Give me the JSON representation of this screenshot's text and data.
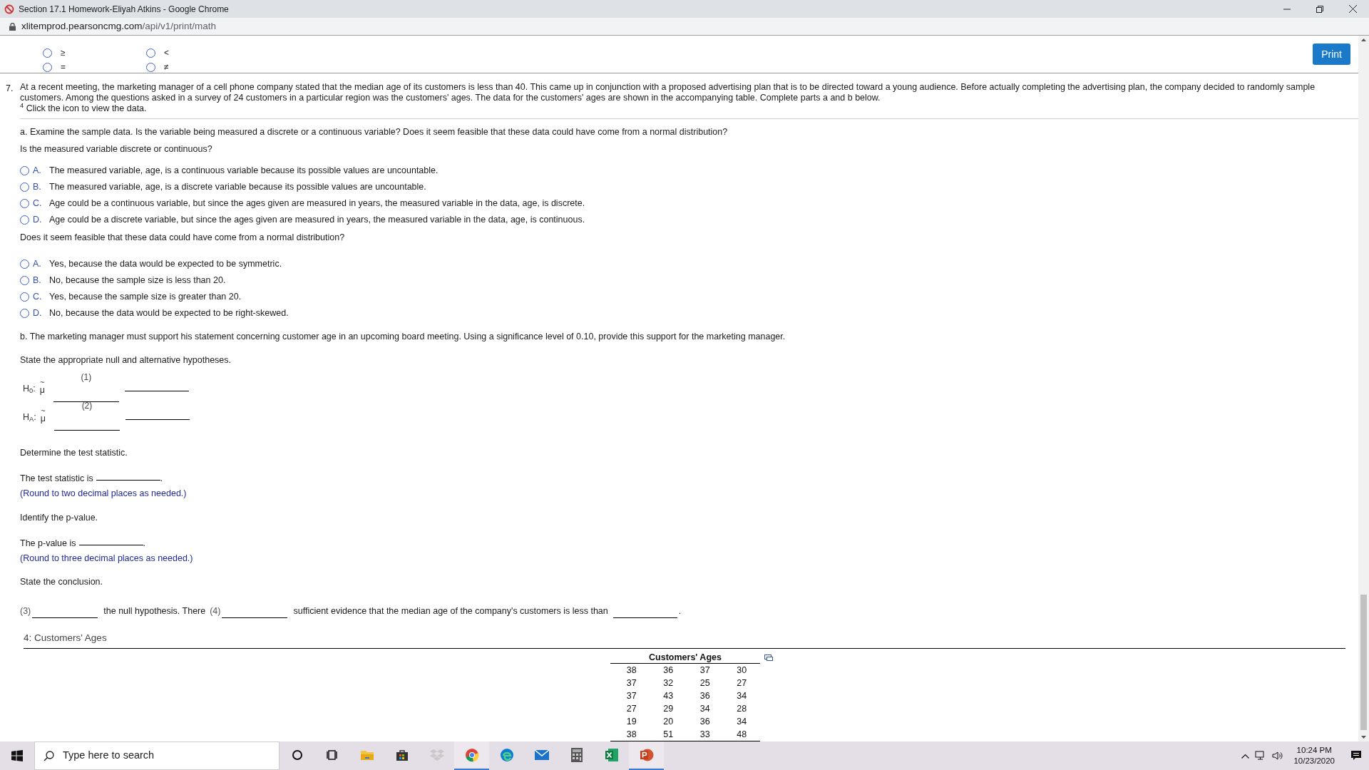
{
  "window": {
    "title": "Section 17.1 Homework-Eliyah Atkins - Google Chrome"
  },
  "address": {
    "host": "xlitemprod.pearsoncmg.com",
    "path": "/api/v1/print/math"
  },
  "choice_columns": [
    [
      {
        "symbol": "≥",
        "selected": false
      },
      {
        "symbol": "=",
        "selected": false
      }
    ],
    [
      {
        "symbol": "<",
        "selected": false
      },
      {
        "symbol": "≠",
        "selected": false
      }
    ]
  ],
  "print_button": "Print",
  "question": {
    "number": "7.",
    "intro": "At a recent meeting, the marketing manager of a cell phone company stated that the median age of its customers is less than 40. This came up in conjunction with a proposed advertising plan that is to be directed toward a young audience. Before actually completing the advertising plan, the company decided to randomly sample customers. Among the questions asked in a survey of 24 customers in a particular region was the customers' ages. The data for the customers' ages are shown in the accompanying table. Complete parts a and b below.",
    "data_note": "$^{4}$ Click the icon to view the data.",
    "part_a": "a. Examine the sample data. Is the variable being measured a discrete or a continuous variable? Does it seem feasible that these data could have come from a normal distribution?",
    "question_1": "Is the measured variable discrete or continuous?",
    "options_1": [
      {
        "letter": "A.",
        "text": "The measured variable, age, is a continuous variable because its possible values are uncountable.",
        "selected": false
      },
      {
        "letter": "B.",
        "text": "The measured variable, age, is a discrete variable because its possible values are uncountable.",
        "selected": false
      },
      {
        "letter": "C.",
        "text": "Age could be a continuous variable, but since the ages given are measured in years, the measured variable in the data, age, is discrete.",
        "selected": false
      },
      {
        "letter": "D.",
        "text": "Age could be a discrete variable, but since the ages given are measured in years, the measured variable in the data, age, is continuous.",
        "selected": false
      }
    ],
    "question_2": "Does it seem feasible that these data could have come from a normal distribution?",
    "options_2": [
      {
        "letter": "A.",
        "text": "Yes, because the data would be expected to be symmetric.",
        "selected": false
      },
      {
        "letter": "B.",
        "text": "No, because the sample size is less than 20.",
        "selected": false
      },
      {
        "letter": "C.",
        "text": "Yes, because the sample size is greater than 20.",
        "selected": false
      },
      {
        "letter": "D.",
        "text": "No, because the data would be expected to be right-skewed.",
        "selected": false
      }
    ],
    "part_b": "b. The marketing manager must support his statement concerning customer age in an upcoming board meeting. Using a significance level of 0.10, provide this support for the marketing manager.",
    "hypotheses_prompt": "State the appropriate null and alternative hypotheses.",
    "hypotheses": [
      {
        "label": "H$_{0}$:",
        "tilde": "~",
        "symbol": "μ",
        "blank_number": "(1)"
      },
      {
        "label": "H$_{A}$:",
        "tilde": "~",
        "symbol": "μ",
        "blank_number": "(2)"
      }
    ],
    "test_statistic": {
      "heading": "Determine the test statistic.",
      "lead": "The test statistic is",
      "end": ".",
      "hint": "(Round to two decimal places as needed.)"
    },
    "p_value": {
      "heading": "Identify the p-value.",
      "lead": "The p-value is",
      "end": ".",
      "hint": "(Round to three decimal places as needed.)"
    },
    "conclusion": {
      "heading": "State the conclusion.",
      "blank_3": "(3)",
      "middle": "the null hypothesis. There",
      "blank_4": "(4)",
      "tail": "sufficient evidence that the median age of the company's customers is less than",
      "end": "."
    }
  },
  "data_panel": {
    "title": "4: Customers' Ages",
    "table_title": "Customers' Ages",
    "rows": [
      [
        "38",
        "36",
        "37",
        "30"
      ],
      [
        "37",
        "32",
        "25",
        "27"
      ],
      [
        "37",
        "43",
        "36",
        "34"
      ],
      [
        "27",
        "29",
        "34",
        "28"
      ],
      [
        "19",
        "20",
        "36",
        "34"
      ],
      [
        "38",
        "51",
        "33",
        "48"
      ]
    ]
  },
  "taskbar": {
    "search_placeholder": "Type here to search",
    "apps": [
      {
        "kind": "cortana",
        "open": false
      },
      {
        "kind": "taskview",
        "open": false
      },
      {
        "kind": "explorer",
        "open": false
      },
      {
        "kind": "store",
        "open": false
      },
      {
        "kind": "dropbox",
        "open": false
      },
      {
        "kind": "chrome",
        "open": true
      },
      {
        "kind": "edge",
        "open": false
      },
      {
        "kind": "mail",
        "open": false
      },
      {
        "kind": "calculator",
        "open": false
      },
      {
        "kind": "excel",
        "open": false
      },
      {
        "kind": "powerpoint",
        "open": true
      }
    ],
    "time": "10:24 PM",
    "date": "10/23/2020"
  }
}
